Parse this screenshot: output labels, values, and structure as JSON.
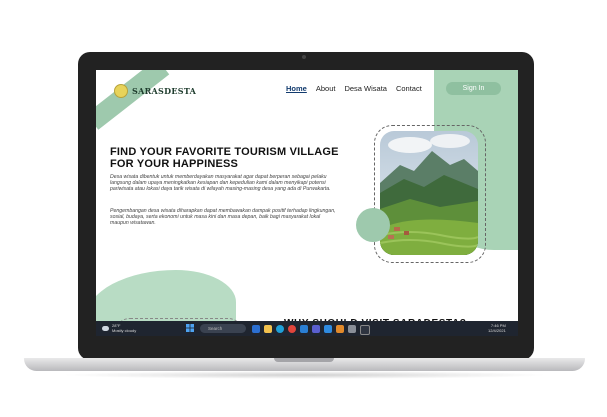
{
  "site": {
    "brand": "SARASDESTA",
    "nav": [
      "Home",
      "About",
      "Desa Wisata",
      "Contact"
    ],
    "signin_label": "Sign In",
    "headline_line1": "FIND YOUR FAVORITE TOURISM VILLAGE",
    "headline_line2": "FOR YOUR HAPPINESS",
    "paragraph1": "Desa wisata dibentuk untuk memberdayakan masyarakat agar dapat berperan sebagai pelaku langsung dalam upaya meningkatkan kesiapan dan kepedulian kami dalam menyikapi potensi pariwisata atau lokasi daya tarik wisata di wilayah masing-masing desa yang ada di Purwakarta.",
    "paragraph2": "Pengembangan desa wisata diharapkan dapat membawakan dampak positif terhadap lingkungan, sosial, budaya, serta ekonomi untuk masa kini dan masa depan, baik bagi masyarakat lokal maupun wisatawan.",
    "why_heading": "WHY SHOULD VISIT SARADESTA?"
  },
  "taskbar": {
    "weather_temp": "28°F",
    "weather_desc": "Mostly cloudy",
    "search_placeholder": "Search",
    "time": "7:46 PM",
    "date": "12/4/2021"
  },
  "colors": {
    "accent_green": "#9ec9ad",
    "nav_active": "#123b6e",
    "taskbar": "#1f2530"
  },
  "taskbar_icons": [
    "start-icon",
    "widgets-icon",
    "file-explorer-icon",
    "edge-icon",
    "chrome-icon",
    "vscode-icon",
    "store-icon",
    "mail-icon",
    "photos-icon",
    "settings-icon",
    "terminal-icon"
  ]
}
